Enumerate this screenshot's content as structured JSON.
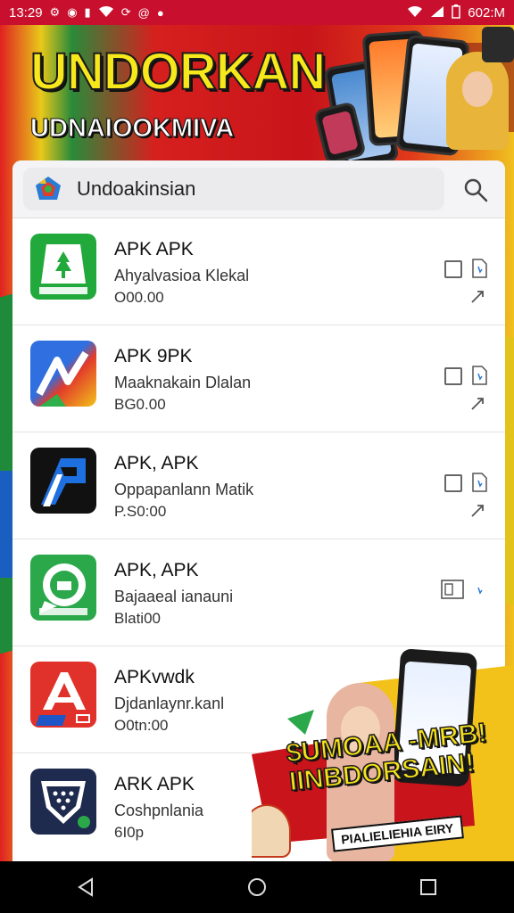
{
  "status_bar": {
    "time": "13:29",
    "right_text": "602:M"
  },
  "banner": {
    "headline": "UNDORKAN",
    "subheadline": "UDNAIOOKMIVA"
  },
  "search": {
    "value": "Undoakinsian"
  },
  "apps": [
    {
      "name": "APK APK",
      "description": "Ahyalvasioa Klekal",
      "price": "O00.00",
      "icon": "green-tree-icon",
      "color": "#22a93c"
    },
    {
      "name": "APK 9PK",
      "description": "Maaknakain Dlalan",
      "price": "BG0.00",
      "icon": "map-arrow-icon",
      "color": "#2f6fe0"
    },
    {
      "name": "APK, APK",
      "description": "Oppapanlann Matik",
      "price": "P.S0:00",
      "icon": "letter-a-icon",
      "color": "#111111"
    },
    {
      "name": "APK, APK",
      "description": "Bajaaeal ianauni",
      "price": "Blati00",
      "icon": "chat-bubble-icon",
      "color": "#2aa84a"
    },
    {
      "name": "APKvwdk",
      "description": "Djdanlaynr.kanl",
      "price": "O0tn:00",
      "icon": "a-logo-icon",
      "color": "#e0322a"
    },
    {
      "name": "ARK APK",
      "description": "Coshpnlania",
      "price": "6I0p",
      "icon": "shield-icon",
      "color": "#1f2b4e"
    }
  ],
  "promo": {
    "line1": "$UMOAA -MRB!",
    "line2": "IINBDORSAIN!",
    "tagline": "PIALIELIEHIA EIRY"
  },
  "nav": {
    "back": "back-icon",
    "home": "home-icon",
    "recents": "recents-icon"
  }
}
